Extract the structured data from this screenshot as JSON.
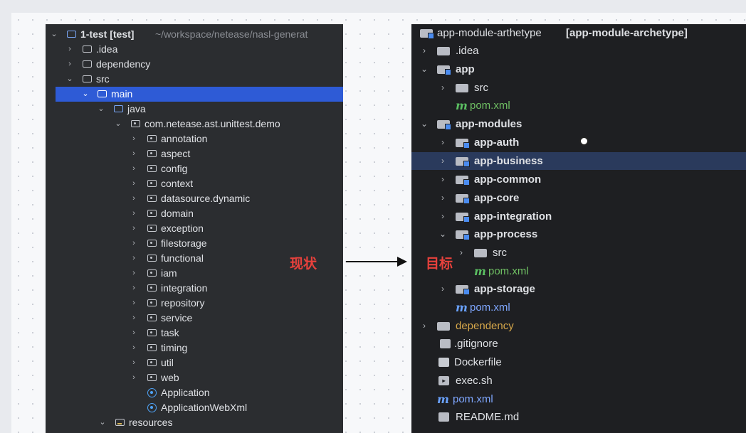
{
  "left_panel": {
    "root_name": "1-test [test]",
    "root_path": " ~/workspace/netease/nasl-generat",
    "items": [
      {
        "label": "1-test [test]"
      },
      {
        "label": ".idea"
      },
      {
        "label": "dependency"
      },
      {
        "label": "src"
      },
      {
        "label": "main"
      },
      {
        "label": "java"
      },
      {
        "label": "com.netease.ast.unittest.demo"
      },
      {
        "label": "annotation"
      },
      {
        "label": "aspect"
      },
      {
        "label": "config"
      },
      {
        "label": "context"
      },
      {
        "label": "datasource.dynamic"
      },
      {
        "label": "domain"
      },
      {
        "label": "exception"
      },
      {
        "label": "filestorage"
      },
      {
        "label": "functional"
      },
      {
        "label": "iam"
      },
      {
        "label": "integration"
      },
      {
        "label": "repository"
      },
      {
        "label": "service"
      },
      {
        "label": "task"
      },
      {
        "label": "timing"
      },
      {
        "label": "util"
      },
      {
        "label": "web"
      },
      {
        "label": "Application"
      },
      {
        "label": "ApplicationWebXml"
      },
      {
        "label": "resources"
      }
    ]
  },
  "right_panel": {
    "root_name": "app-module-arthetype",
    "root_bold": "[app-module-archetype]",
    "items": [
      {
        "label": ".idea"
      },
      {
        "label": "app"
      },
      {
        "label": "src"
      },
      {
        "label": "pom.xml"
      },
      {
        "label": "app-modules"
      },
      {
        "label": "app-auth"
      },
      {
        "label": "app-business"
      },
      {
        "label": "app-common"
      },
      {
        "label": "app-core"
      },
      {
        "label": "app-integration"
      },
      {
        "label": "app-process"
      },
      {
        "label": "src"
      },
      {
        "label": "pom.xml"
      },
      {
        "label": "app-storage"
      },
      {
        "label": "pom.xml"
      },
      {
        "label": "dependency"
      },
      {
        "label": ".gitignore"
      },
      {
        "label": "Dockerfile"
      },
      {
        "label": "exec.sh"
      },
      {
        "label": "pom.xml"
      },
      {
        "label": "README.md"
      }
    ]
  },
  "labels": {
    "current": "现状",
    "target": "目标"
  },
  "icons": {
    "maven": "m",
    "shell": "▸"
  },
  "colors": {
    "selection_left": "#2e5bd6",
    "selection_right": "#2a3a5c",
    "annotation_red": "#e8413c"
  }
}
